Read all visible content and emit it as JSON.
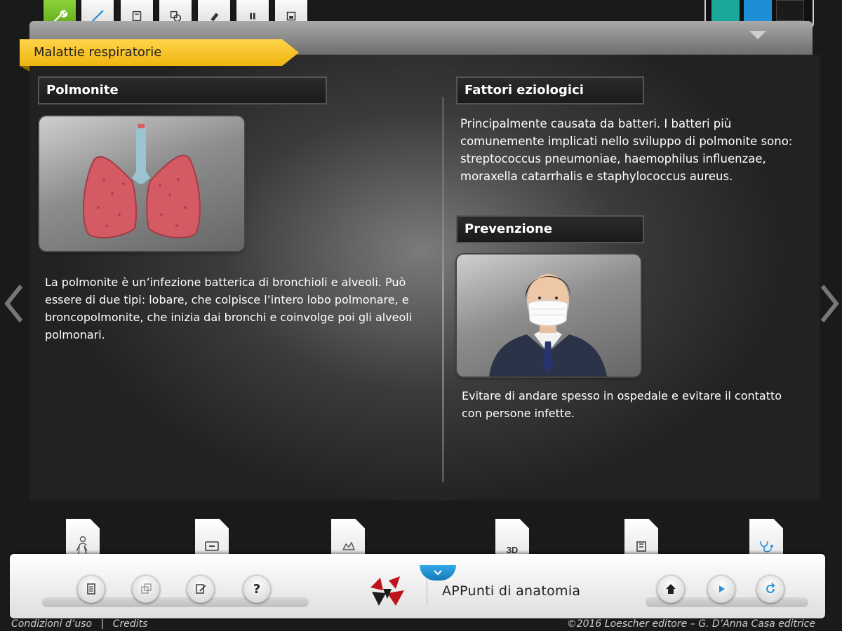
{
  "toolbar": {
    "tools": [
      "wrench-icon",
      "pen-icon",
      "note-icon",
      "shapes-icon",
      "eraser-icon",
      "pause-icon",
      "save-icon"
    ]
  },
  "swatches": [
    "#1aa89a",
    "#1e8fd6",
    "#1b1b1b"
  ],
  "header": {
    "title": "Malattie respiratorie"
  },
  "left": {
    "heading": "Polmonite",
    "image": "lungs-illustration",
    "text": "La polmonite è un’infezione batterica di bronchioli e alveoli. Può essere di due tipi: lobare, che colpisce l’intero lobo polmonare, e broncopolmonite, che inizia dai bronchi e coinvolge poi gli alveoli polmonari."
  },
  "right": {
    "heading1": "Fattori eziologici",
    "text1": "Principalmente causata da batteri. I batteri più comunemente implicati nello sviluppo di polmonite sono: streptococcus pneumoniae, haemophilus influenzae, moraxella catarrhalis e staphylococcus aureus.",
    "heading2": "Prevenzione",
    "image": "man-with-mask-illustration",
    "text2": "Evitare di andare spesso in ospedale e evitare il contatto con persone infette."
  },
  "tabs": [
    {
      "icon": "body-icon"
    },
    {
      "icon": "monitor-icon"
    },
    {
      "icon": "hand-icon"
    },
    {
      "label": "3D"
    },
    {
      "icon": "book-icon"
    },
    {
      "icon": "stethoscope-icon"
    }
  ],
  "bottom": {
    "app_title": "APPunti di anatomia",
    "help_label": "?"
  },
  "footer": {
    "terms": "Condizioni d’uso",
    "credits": "Credits",
    "copyright": "©2016 Loescher editore – G. D’Anna Casa editrice"
  }
}
